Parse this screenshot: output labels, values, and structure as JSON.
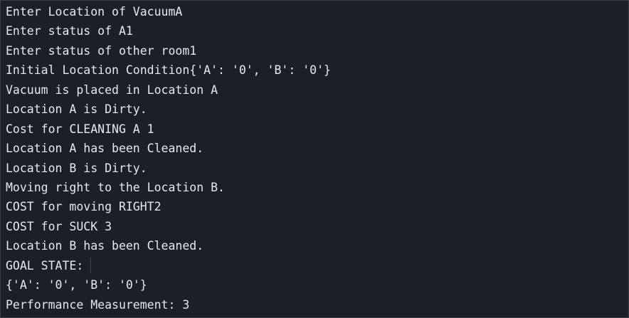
{
  "terminal": {
    "lines": [
      "Enter Location of VacuumA",
      "Enter status of A1",
      "Enter status of other room1",
      "Initial Location Condition{'A': '0', 'B': '0'}",
      "Vacuum is placed in Location A",
      "Location A is Dirty.",
      "Cost for CLEANING A 1",
      "Location A has been Cleaned.",
      "Location B is Dirty.",
      "Moving right to the Location B.",
      "COST for moving RIGHT2",
      "COST for SUCK 3",
      "Location B has been Cleaned.",
      "GOAL STATE:",
      "{'A': '0', 'B': '0'}",
      "Performance Measurement: 3"
    ]
  },
  "colors": {
    "background": "#1b1f28",
    "text": "#e6e8ec",
    "border": "#3a3f4b"
  }
}
